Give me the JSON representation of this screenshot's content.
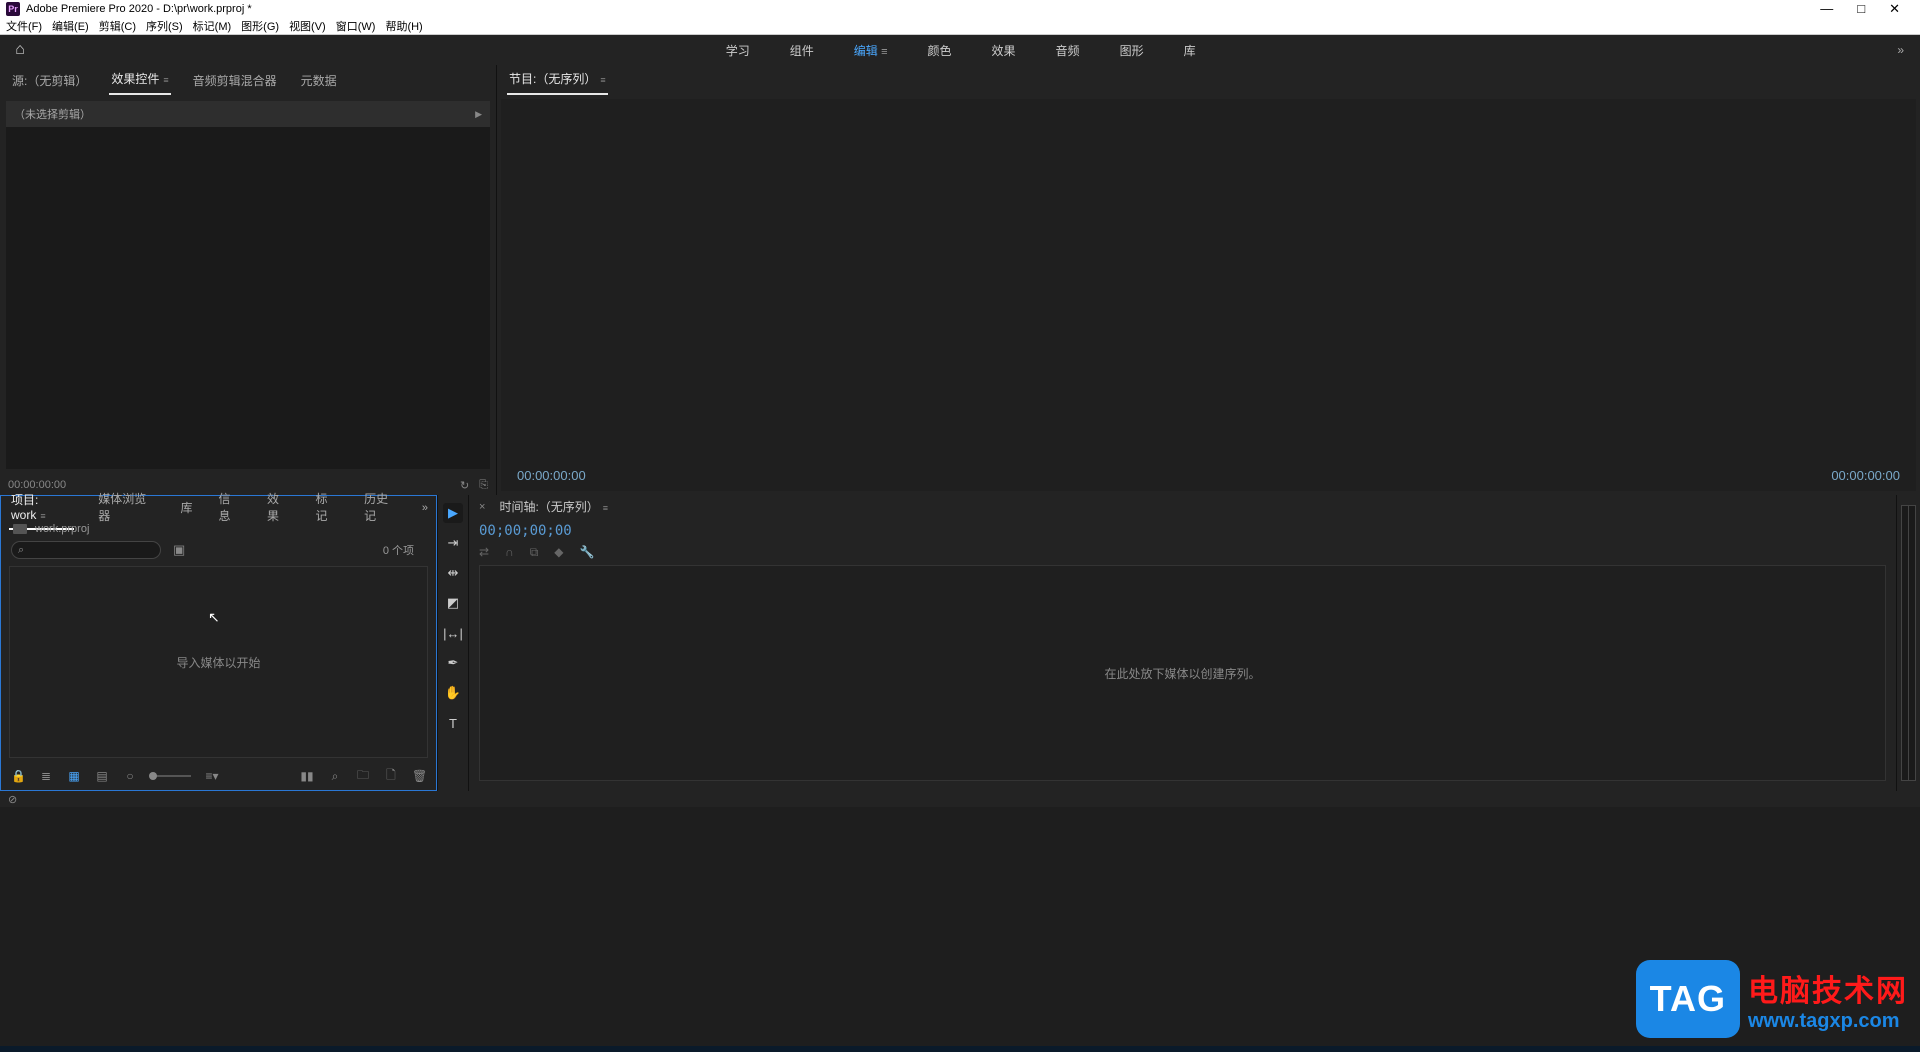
{
  "titlebar": {
    "title": "Adobe Premiere Pro 2020 - D:\\pr\\work.prproj *"
  },
  "menu": {
    "items": [
      "文件(F)",
      "编辑(E)",
      "剪辑(C)",
      "序列(S)",
      "标记(M)",
      "图形(G)",
      "视图(V)",
      "窗口(W)",
      "帮助(H)"
    ]
  },
  "workspace": {
    "tabs": [
      "学习",
      "组件",
      "编辑",
      "颜色",
      "效果",
      "音频",
      "图形",
      "库"
    ],
    "active_index": 2
  },
  "source_panel": {
    "tabs": [
      "源:（无剪辑）",
      "效果控件",
      "音频剪辑混合器",
      "元数据"
    ],
    "active_index": 1,
    "no_clip_text": "（未选择剪辑）",
    "timecode": "00:00:00:00"
  },
  "program_panel": {
    "tab": "节目:（无序列）",
    "left_tc": "00:00:00:00",
    "right_tc": "00:00:00:00"
  },
  "project_panel": {
    "tabs": [
      "项目: work",
      "媒体浏览器",
      "库",
      "信息",
      "效果",
      "标记",
      "历史记"
    ],
    "active_index": 0,
    "filename": "work.prproj",
    "item_count": "0 个项",
    "empty_text": "导入媒体以开始"
  },
  "timeline_panel": {
    "tab": "时间轴:（无序列）",
    "timecode": "00;00;00;00",
    "empty_text": "在此处放下媒体以创建序列。"
  },
  "watermark": {
    "tag": "TAG",
    "line1": "电脑技术网",
    "line2": "www.tagxp.com"
  }
}
